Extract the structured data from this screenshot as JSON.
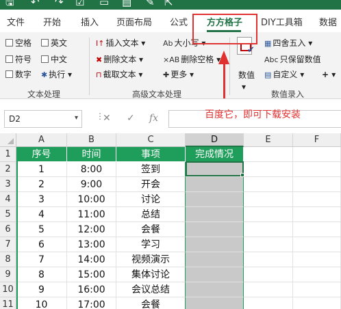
{
  "titlebar": {
    "icons": [
      "save-icon",
      "undo-icon",
      "redo-icon",
      "checkbox-icon",
      "new-file-icon",
      "paste-icon",
      "brush-icon",
      "cursor-icon"
    ],
    "glyphs": [
      "🖫",
      "↶",
      "↷",
      "☑",
      "▭",
      "▤",
      "✎",
      "⇱"
    ]
  },
  "ribbon_tabs": [
    "文件",
    "开始",
    "插入",
    "页面布局",
    "公式",
    "方方格子",
    "DIY工具箱",
    "数据"
  ],
  "active_tab": "方方格子",
  "ribbon": {
    "text_group": {
      "label": "文本处理",
      "options": [
        "空格",
        "英文",
        "符号",
        "中文",
        "数字"
      ],
      "execute": "执行"
    },
    "adv_group": {
      "label": "高级文本处理",
      "insert_text": "插入文本",
      "delete_text": "删除文本",
      "extract_text": "截取文本",
      "case": "大小写",
      "delete_space": "删除空格",
      "more": "更多"
    },
    "value_group": {
      "label": "数值录入",
      "value_button": "数值",
      "round": "四舍五入",
      "keep_value": "只保留数值",
      "custom": "自定义",
      "plus": "+"
    }
  },
  "annotation": {
    "text": "百度它，即可下载安装",
    "color": "#e03030"
  },
  "formula_bar": {
    "name_box": "D2",
    "cancel_icon": "✕",
    "confirm_icon": "✓",
    "fx_label": "fx",
    "content": ""
  },
  "sheet": {
    "columns": [
      "A",
      "B",
      "C",
      "D",
      "E",
      "F"
    ],
    "selected_column": "D",
    "rows": [
      "1",
      "2",
      "3",
      "4",
      "5",
      "6",
      "7",
      "8",
      "9",
      "10",
      "11"
    ],
    "headers": [
      "序号",
      "时间",
      "事项",
      "完成情况"
    ],
    "data": [
      [
        "1",
        "8:00",
        "签到",
        ""
      ],
      [
        "2",
        "9:00",
        "开会",
        ""
      ],
      [
        "3",
        "10:00",
        "讨论",
        ""
      ],
      [
        "4",
        "11:00",
        "总结",
        ""
      ],
      [
        "5",
        "12:00",
        "会餐",
        ""
      ],
      [
        "6",
        "13:00",
        "学习",
        ""
      ],
      [
        "7",
        "14:00",
        "视频演示",
        ""
      ],
      [
        "8",
        "15:00",
        "集体讨论",
        ""
      ],
      [
        "9",
        "16:00",
        "会议总结",
        ""
      ],
      [
        "10",
        "17:00",
        "会餐",
        ""
      ]
    ],
    "header_fill": "#1f9e5b",
    "completion_fill": "#c9c9c9"
  }
}
